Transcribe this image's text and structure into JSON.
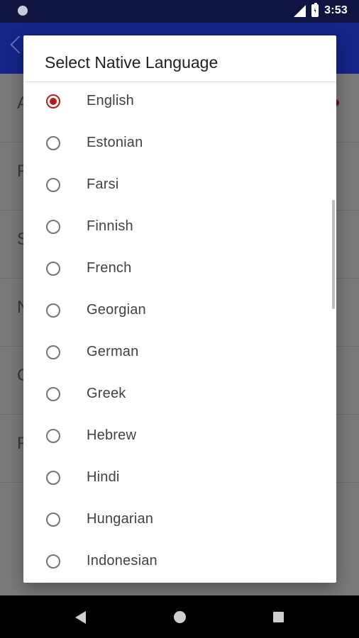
{
  "status_bar": {
    "time": "3:53"
  },
  "dialog": {
    "title": "Select Native Language",
    "options": [
      {
        "label": "English",
        "selected": true
      },
      {
        "label": "Estonian",
        "selected": false
      },
      {
        "label": "Farsi",
        "selected": false
      },
      {
        "label": "Finnish",
        "selected": false
      },
      {
        "label": "French",
        "selected": false
      },
      {
        "label": "Georgian",
        "selected": false
      },
      {
        "label": "German",
        "selected": false
      },
      {
        "label": "Greek",
        "selected": false
      },
      {
        "label": "Hebrew",
        "selected": false
      },
      {
        "label": "Hindi",
        "selected": false
      },
      {
        "label": "Hungarian",
        "selected": false
      },
      {
        "label": "Indonesian",
        "selected": false
      }
    ]
  },
  "background_rows": [
    "A",
    "F",
    "S",
    "N",
    "C",
    "F"
  ],
  "colors": {
    "accent": "#b71c1c",
    "status_bar": "#0f1440",
    "app_bar": "#142487"
  }
}
